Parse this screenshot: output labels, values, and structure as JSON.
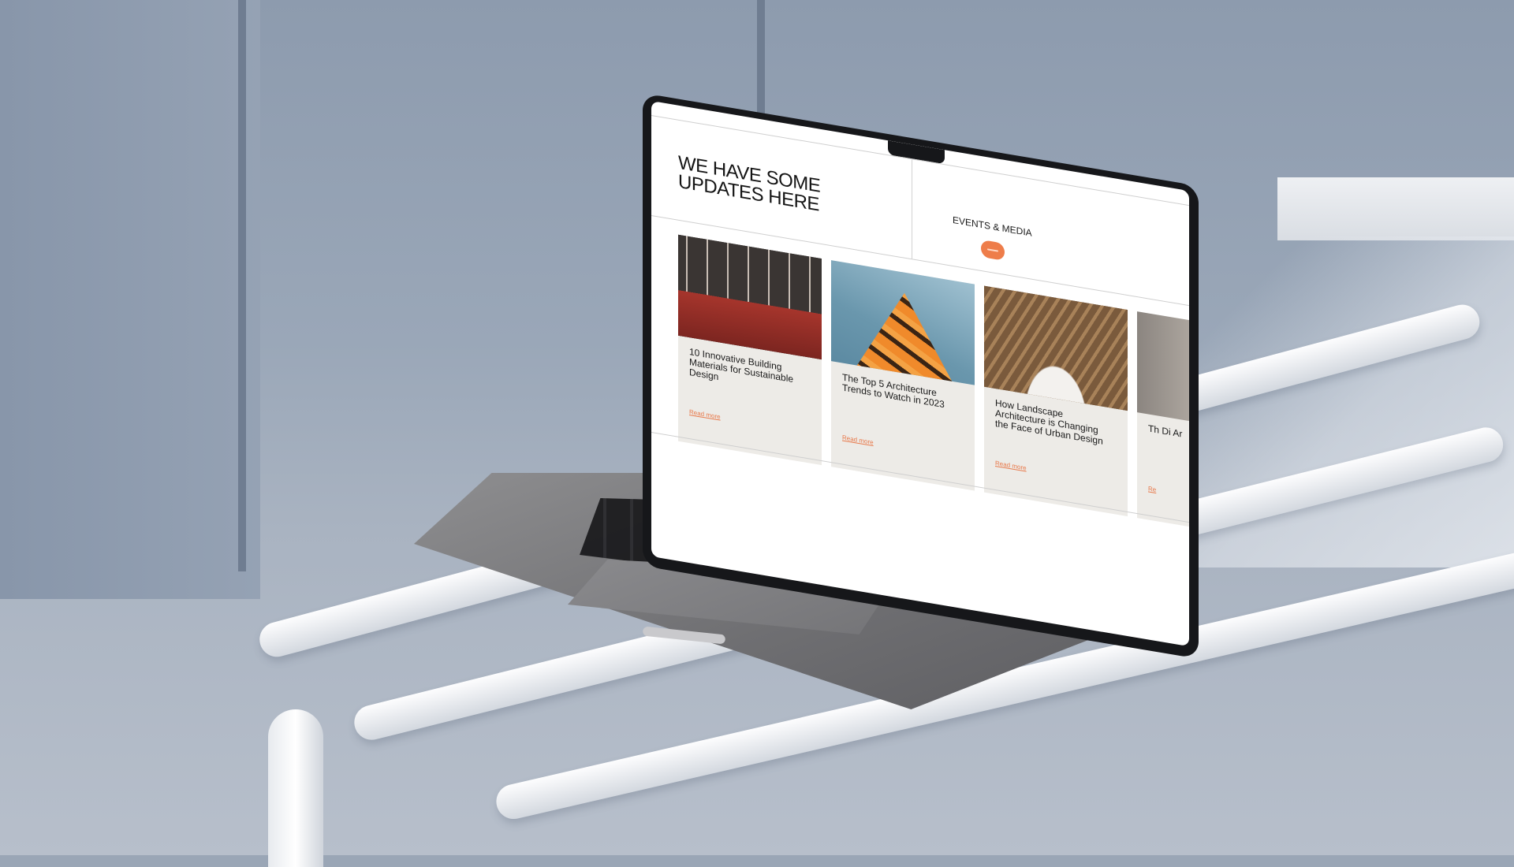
{
  "site": {
    "headline": "WE HAVE SOME UPDATES HERE",
    "section_label": "EVENTS & MEDIA",
    "accent_color": "#ee7d4a"
  },
  "cards": [
    {
      "title": "10 Innovative Building Materials for Sustainable Design",
      "link": "Read more"
    },
    {
      "title": "The Top 5 Architecture Trends to Watch in 2023",
      "link": "Read more"
    },
    {
      "title": "How Landscape Architecture is Changing the Face of Urban Design",
      "link": "Read more"
    },
    {
      "title": "Th Di Ar",
      "link": "Re"
    }
  ]
}
